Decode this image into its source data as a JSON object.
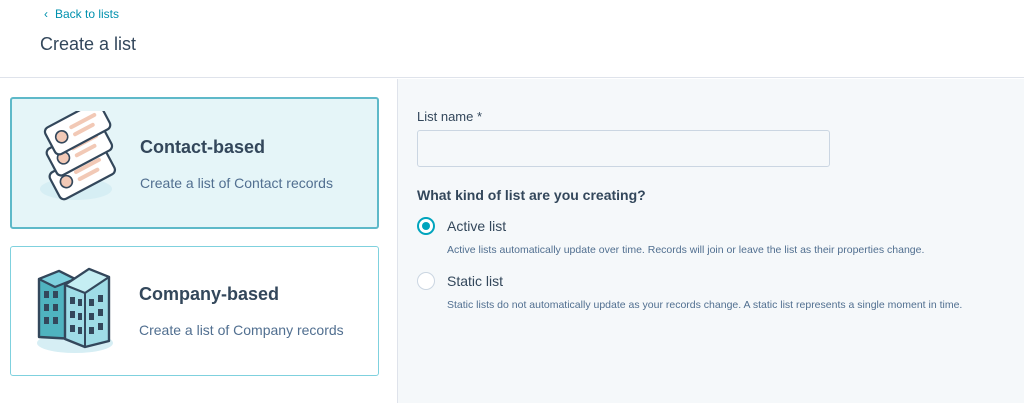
{
  "header": {
    "back_label": "Back to lists",
    "title": "Create a list"
  },
  "cards": {
    "contact": {
      "title": "Contact-based",
      "description": "Create a list of Contact records",
      "selected": true
    },
    "company": {
      "title": "Company-based",
      "description": "Create a list of Company records",
      "selected": false
    }
  },
  "form": {
    "name_label": "List name *",
    "name_value": "",
    "question": "What kind of list are you creating?",
    "options": [
      {
        "label": "Active list",
        "help": "Active lists automatically update over time. Records will join or leave the list as their properties change.",
        "checked": true
      },
      {
        "label": "Static list",
        "help": "Static lists do not automatically update as your records change. A static list represents a single moment in time.",
        "checked": false
      }
    ]
  },
  "colors": {
    "accent": "#00a4bd",
    "link": "#0091ae",
    "text": "#33475b",
    "selected_card_bg": "#e5f5f8"
  }
}
